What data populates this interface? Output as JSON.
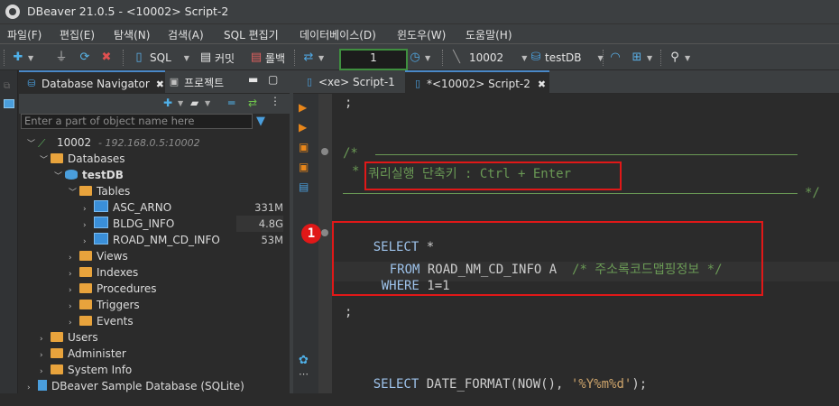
{
  "window": {
    "title": "DBeaver 21.0.5 - <10002> Script-2"
  },
  "menu": [
    "파일(F)",
    "편집(E)",
    "탐색(N)",
    "검색(A)",
    "SQL 편집기",
    "데이터베이스(D)",
    "윈도우(W)",
    "도움말(H)"
  ],
  "toolbar": {
    "sql_label": "SQL",
    "commit_label": "커밋",
    "rollback_label": "롤백",
    "txn_count": "1",
    "connection": "10002",
    "database": "testDB"
  },
  "navigator": {
    "tabs": [
      "Database Navigator",
      "프로젝트"
    ],
    "filter_placeholder": "Enter a part of object name here",
    "tree": {
      "connection_name": "10002",
      "connection_host": "- 192.168.0.5:10002",
      "databases_label": "Databases",
      "db_name": "testDB",
      "tables_label": "Tables",
      "tables": [
        {
          "name": "ASC_ARNO",
          "size": "331M"
        },
        {
          "name": "BLDG_INFO",
          "size": "4.8G"
        },
        {
          "name": "ROAD_NM_CD_INFO",
          "size": "53M"
        }
      ],
      "db_children": [
        "Views",
        "Indexes",
        "Procedures",
        "Triggers",
        "Events"
      ],
      "conn_children": [
        "Users",
        "Administer",
        "System Info"
      ],
      "sample_db": "DBeaver Sample Database (SQLite)"
    }
  },
  "editor": {
    "tabs": [
      "<xe> Script-1",
      "*<10002> Script-2"
    ],
    "lines": {
      "top": ";",
      "comment_open": "/* ",
      "comment_star": "* ",
      "shortcut": "쿼리실행 단축키 : Ctrl + Enter",
      "comment_close": "*/",
      "select_kw": "SELECT",
      "select_rest": " *",
      "from_kw": "FROM",
      "from_table": " ROAD_NM_CD_INFO A  ",
      "from_comment": "/* 주소록코드맵핑정보 */",
      "where_kw": "WHERE",
      "where_rest": " 1=1",
      "semicolon": ";",
      "select2_kw": "SELECT",
      "select2_rest": " DATE_FORMAT(NOW(), ",
      "select2_str": "'%Y%m%d'",
      "select2_end": ");"
    },
    "annotation_number": "1"
  },
  "colors": {
    "annotation": "#e01818",
    "keyword": "#9dc2ea",
    "comment": "#6a9955",
    "txn_border": "#3f8f3f"
  }
}
